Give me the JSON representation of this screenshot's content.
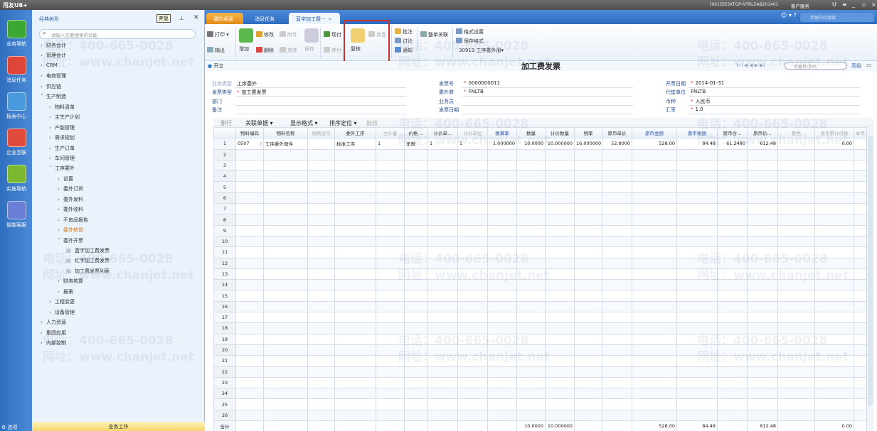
{
  "titlebar": {
    "logo": "用友U8+",
    "account": "[001]DESKTOP-NTRL5AB201401",
    "service": "客户服务",
    "window_buttons": [
      "U",
      "≡",
      "_",
      "▫",
      "×"
    ]
  },
  "rail": [
    {
      "label": "业务导航",
      "color": "#3aa832"
    },
    {
      "label": "消息任务",
      "color": "#e0453a"
    },
    {
      "label": "报表中心",
      "color": "#4a9ae0"
    },
    {
      "label": "企业互联",
      "color": "#e04a3a"
    },
    {
      "label": "实施导航",
      "color": "#7ab830"
    },
    {
      "label": "智能客服",
      "color": "#6a7ed8"
    }
  ],
  "nav": {
    "title": "经典树形",
    "tooltip": "弃复",
    "search_placeholder": "请输入您要搜索的功能",
    "items": [
      {
        "label": "财务会计",
        "level": 0,
        "state": "collapsed"
      },
      {
        "label": "管理会计",
        "level": 0,
        "state": "collapsed"
      },
      {
        "label": "CRM",
        "level": 0,
        "state": "collapsed"
      },
      {
        "label": "电商管理",
        "level": 0,
        "state": "collapsed"
      },
      {
        "label": "供应链",
        "level": 0,
        "state": "collapsed"
      },
      {
        "label": "生产制造",
        "level": 0,
        "state": "expanded"
      },
      {
        "label": "物料清单",
        "level": 1,
        "state": "collapsed"
      },
      {
        "label": "主生产计划",
        "level": 1,
        "state": "collapsed"
      },
      {
        "label": "产能管理",
        "level": 1,
        "state": "collapsed"
      },
      {
        "label": "需求规划",
        "level": 1,
        "state": "collapsed"
      },
      {
        "label": "生产订单",
        "level": 1,
        "state": "collapsed"
      },
      {
        "label": "车间管理",
        "level": 1,
        "state": "collapsed"
      },
      {
        "label": "工序委外",
        "level": 1,
        "state": "expanded"
      },
      {
        "label": "设置",
        "level": 2,
        "state": "collapsed"
      },
      {
        "label": "委外订货",
        "level": 2,
        "state": "collapsed"
      },
      {
        "label": "委外发料",
        "level": 2,
        "state": "collapsed"
      },
      {
        "label": "委外收料",
        "level": 2,
        "state": "collapsed"
      },
      {
        "label": "不良品报告",
        "level": 2,
        "state": "collapsed"
      },
      {
        "label": "委外核销",
        "level": 2,
        "state": "collapsed",
        "selected": true
      },
      {
        "label": "委外开票",
        "level": 2,
        "state": "expanded"
      },
      {
        "label": "蓝字加工费发票",
        "level": 3,
        "state": "leaf"
      },
      {
        "label": "红字加工费发票",
        "level": 3,
        "state": "leaf"
      },
      {
        "label": "加工费发票列表",
        "level": 3,
        "state": "leaf"
      },
      {
        "label": "财务核算",
        "level": 2,
        "state": "collapsed"
      },
      {
        "label": "报表",
        "level": 2,
        "state": "collapsed"
      },
      {
        "label": "工程变更",
        "level": 1,
        "state": "collapsed"
      },
      {
        "label": "设备管理",
        "level": 1,
        "state": "collapsed"
      },
      {
        "label": "人力资源",
        "level": 0,
        "state": "collapsed"
      },
      {
        "label": "集团应用",
        "level": 0,
        "state": "collapsed"
      },
      {
        "label": "内部控制",
        "level": 0,
        "state": "collapsed"
      }
    ],
    "bottom_tab": "业务工作",
    "bottom_left": "选项"
  },
  "tabs": [
    {
      "label": "我的桌面"
    },
    {
      "label": "消息任务"
    },
    {
      "label": "蓝字加工费···",
      "close": "×"
    }
  ],
  "top_search_placeholder": "单据号码搜索",
  "toolbar": {
    "print": "打印",
    "export": "输出",
    "add": "增加",
    "modify": "修改",
    "attach": "附件",
    "delete": "删除",
    "abandon": "放弃",
    "save": "保存",
    "pay": "现付",
    "abandon_pay": "弃付",
    "review": "复核",
    "unreview": "弃复",
    "annotate": "批注",
    "discuss": "讨论",
    "notify": "通知",
    "link": "整单关联",
    "format_setting": "格式设置",
    "save_format": "保存格式",
    "template": "30919 工序委外册"
  },
  "subbar": {
    "status": "开立",
    "title": "加工费发票",
    "search_placeholder": "单据号/条码",
    "advanced": "高级"
  },
  "form": {
    "business_type": {
      "label": "业务类型",
      "value": "工序委外"
    },
    "invoice_type": {
      "label": "发票类型",
      "value": "加工费发票"
    },
    "department": {
      "label": "部门",
      "value": ""
    },
    "remark": {
      "label": "备注",
      "value": ""
    },
    "invoice_no": {
      "label": "发票号",
      "value": "0000000011"
    },
    "supplier": {
      "label": "委外商",
      "value": "FNLTB"
    },
    "salesman": {
      "label": "业务员",
      "value": ""
    },
    "invoice_date": {
      "label": "发票日期",
      "value": ""
    },
    "open_date": {
      "label": "开票日期",
      "value": "2014-01-31"
    },
    "payee": {
      "label": "代垫单位",
      "value": "FNLTB"
    },
    "currency": {
      "label": "币种",
      "value": "人民币"
    },
    "rate": {
      "label": "汇率",
      "value": "1.0"
    }
  },
  "gridbar": {
    "delete_row": "删行",
    "link_docs": "关联单据",
    "display_format": "显示格式",
    "sort": "排序定位",
    "batch": "批改"
  },
  "grid": {
    "columns": [
      "物料编码",
      "物料名称",
      "规格型号",
      "委外工序",
      "主计量",
      "价格 ...",
      "计价单...",
      "计价单位",
      "换算率",
      "数量",
      "计价数量",
      "税率",
      "原币单价",
      "原币金额",
      "原币税额",
      "原币含...",
      "原币价...",
      "颜色",
      "原币累计付款",
      "本币"
    ],
    "rows": [
      [
        "0507",
        "工序委外母件",
        "",
        "标准工序",
        "1",
        "无税",
        "1",
        "1",
        "1.000000",
        "10.0000",
        "10.000000",
        "16.000000",
        "52.8000",
        "528.00",
        "84.48",
        "61.2480",
        "612.48",
        "",
        "0.00",
        ""
      ]
    ],
    "row_count": 26,
    "total_label": "合计",
    "totals": [
      "",
      "",
      "",
      "",
      "",
      "",
      "",
      "",
      "",
      "10.0000",
      "10.000000",
      "",
      "",
      "528.00",
      "84.48",
      "",
      "612.48",
      "",
      "0.00",
      ""
    ]
  },
  "watermark": {
    "phone": "电话：400-665-0028",
    "site": "网址：www.chanjet.net"
  }
}
